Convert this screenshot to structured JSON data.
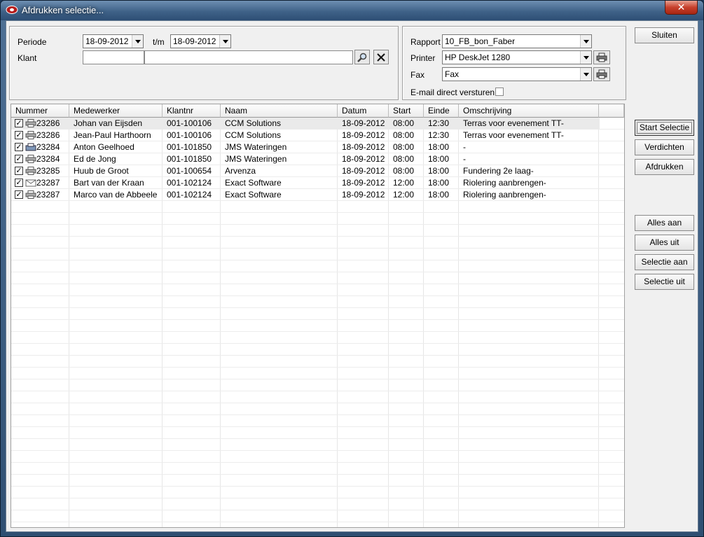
{
  "window": {
    "title": "Afdrukken selectie...",
    "close_glyph": "✕"
  },
  "filter": {
    "periode_label": "Periode",
    "periode_from": "18-09-2012",
    "tm_label": "t/m",
    "periode_to": "18-09-2012",
    "klant_label": "Klant",
    "klant_code": "",
    "klant_name": ""
  },
  "output": {
    "rapport_label": "Rapport",
    "rapport_value": "10_FB_bon_Faber",
    "printer_label": "Printer",
    "printer_value": "HP DeskJet 1280",
    "fax_label": "Fax",
    "fax_value": "Fax",
    "email_label": "E-mail direct versturen",
    "email_checked": false
  },
  "buttons": {
    "sluiten": "Sluiten",
    "start_selectie": "Start Selectie",
    "verdichten": "Verdichten",
    "afdrukken": "Afdrukken",
    "alles_aan": "Alles aan",
    "alles_uit": "Alles uit",
    "selectie_aan": "Selectie aan",
    "selectie_uit": "Selectie uit"
  },
  "table": {
    "columns": [
      "Nummer",
      "Medewerker",
      "Klantnr",
      "Naam",
      "Datum",
      "Start",
      "Einde",
      "Omschrijving"
    ],
    "rows": [
      {
        "checked": true,
        "icon": "printer-icon",
        "nummer": "23286",
        "medewerker": "Johan van Eijsden",
        "klantnr": "001-100106",
        "naam": "CCM Solutions",
        "datum": "18-09-2012",
        "start": "08:00",
        "einde": "12:30",
        "omschrijving": "Terras voor evenement TT-"
      },
      {
        "checked": true,
        "icon": "printer-icon",
        "nummer": "23286",
        "medewerker": "Jean-Paul Harthoorn",
        "klantnr": "001-100106",
        "naam": "CCM Solutions",
        "datum": "18-09-2012",
        "start": "08:00",
        "einde": "12:30",
        "omschrijving": "Terras voor evenement TT-"
      },
      {
        "checked": true,
        "icon": "fax-icon",
        "nummer": "23284",
        "medewerker": "Anton Geelhoed",
        "klantnr": "001-101850",
        "naam": "JMS Wateringen",
        "datum": "18-09-2012",
        "start": "08:00",
        "einde": "18:00",
        "omschrijving": "-"
      },
      {
        "checked": true,
        "icon": "printer-icon",
        "nummer": "23284",
        "medewerker": "Ed de Jong",
        "klantnr": "001-101850",
        "naam": "JMS Wateringen",
        "datum": "18-09-2012",
        "start": "08:00",
        "einde": "18:00",
        "omschrijving": "-"
      },
      {
        "checked": true,
        "icon": "printer-icon",
        "nummer": "23285",
        "medewerker": "Huub de Groot",
        "klantnr": "001-100654",
        "naam": "Arvenza",
        "datum": "18-09-2012",
        "start": "08:00",
        "einde": "18:00",
        "omschrijving": "Fundering 2e laag-"
      },
      {
        "checked": true,
        "icon": "email-icon",
        "nummer": "23287",
        "medewerker": "Bart van der Kraan",
        "klantnr": "001-102124",
        "naam": "Exact Software",
        "datum": "18-09-2012",
        "start": "12:00",
        "einde": "18:00",
        "omschrijving": "Riolering aanbrengen-"
      },
      {
        "checked": true,
        "icon": "printer-icon",
        "nummer": "23287",
        "medewerker": "Marco van de Abbeele",
        "klantnr": "001-102124",
        "naam": "Exact Software",
        "datum": "18-09-2012",
        "start": "12:00",
        "einde": "18:00",
        "omschrijving": "Riolering aanbrengen-"
      }
    ]
  },
  "colors": {
    "title_bar": "#3f6288",
    "close_button": "#c7402c",
    "selected_row": "#eaeaea"
  }
}
